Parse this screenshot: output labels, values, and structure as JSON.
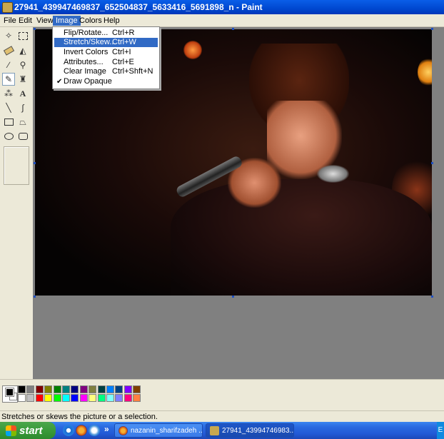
{
  "window": {
    "title": "27941_439947469837_652504837_5633416_5691898_n - Paint"
  },
  "menubar": {
    "items": [
      {
        "label": "File"
      },
      {
        "label": "Edit"
      },
      {
        "label": "View"
      },
      {
        "label": "Image"
      },
      {
        "label": "Colors"
      },
      {
        "label": "Help"
      }
    ]
  },
  "image_menu": {
    "items": [
      {
        "label": "Flip/Rotate...",
        "shortcut": "Ctrl+R"
      },
      {
        "label": "Stretch/Skew...",
        "shortcut": "Ctrl+W"
      },
      {
        "label": "Invert Colors",
        "shortcut": "Ctrl+I"
      },
      {
        "label": "Attributes...",
        "shortcut": "Ctrl+E"
      },
      {
        "label": "Clear Image",
        "shortcut": "Ctrl+Shft+N"
      },
      {
        "label": "Draw Opaque",
        "shortcut": ""
      }
    ]
  },
  "tools": [
    "free-form-select-icon",
    "select-icon",
    "eraser-icon",
    "fill-icon",
    "pick-color-icon",
    "magnifier-icon",
    "pencil-icon",
    "brush-icon",
    "airbrush-icon",
    "text-icon",
    "line-icon",
    "curve-icon",
    "rectangle-icon",
    "polygon-icon",
    "ellipse-icon",
    "rounded-rectangle-icon"
  ],
  "palette": {
    "row1": [
      "#000000",
      "#808080",
      "#800000",
      "#808000",
      "#008000",
      "#008080",
      "#000080",
      "#800080",
      "#808040",
      "#004040",
      "#0080ff",
      "#004080",
      "#8000ff",
      "#804000"
    ],
    "row2": [
      "#ffffff",
      "#c0c0c0",
      "#ff0000",
      "#ffff00",
      "#00ff00",
      "#00ffff",
      "#0000ff",
      "#ff00ff",
      "#ffff80",
      "#00ff80",
      "#80ffff",
      "#8080ff",
      "#ff0080",
      "#ff8040"
    ],
    "foreground": "#000000",
    "background": "#ffffff"
  },
  "status": {
    "text": "Stretches or skews the picture or a selection."
  },
  "taskbar": {
    "start_label": "start",
    "quicklaunch_more": "»",
    "buttons": [
      {
        "label": "nazanin_sharifzadeh ..."
      },
      {
        "label": "27941_43994746983..."
      }
    ],
    "tray_label": "E"
  }
}
